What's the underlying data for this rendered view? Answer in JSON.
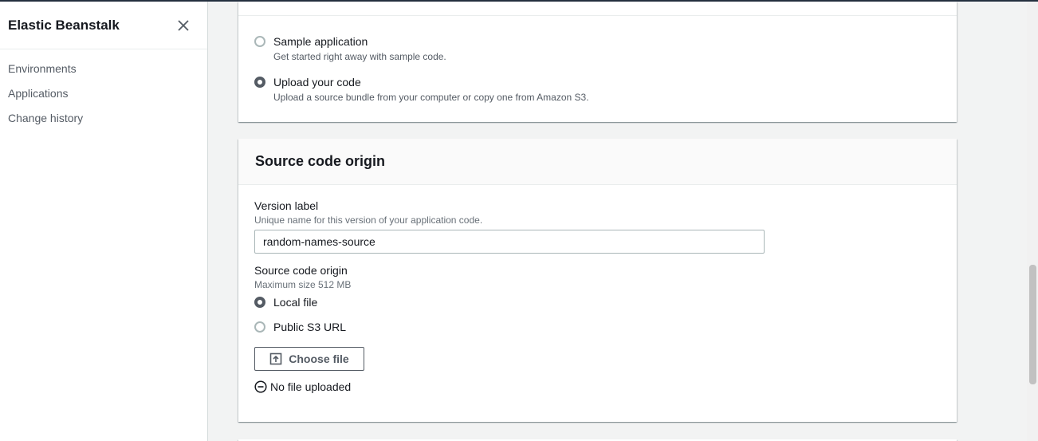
{
  "sidebar": {
    "title": "Elastic Beanstalk",
    "close_icon": "close-icon",
    "items": [
      {
        "label": "Environments"
      },
      {
        "label": "Applications"
      },
      {
        "label": "Change history"
      }
    ]
  },
  "application_code": {
    "options": [
      {
        "label": "Sample application",
        "description": "Get started right away with sample code.",
        "selected": false
      },
      {
        "label": "Upload your code",
        "description": "Upload a source bundle from your computer or copy one from Amazon S3.",
        "selected": true
      }
    ]
  },
  "source_code_origin": {
    "title": "Source code origin",
    "version_label": {
      "label": "Version label",
      "description": "Unique name for this version of your application code.",
      "value": "random-names-source"
    },
    "origin": {
      "label": "Source code origin",
      "description": "Maximum size 512 MB",
      "options": [
        {
          "label": "Local file",
          "selected": true
        },
        {
          "label": "Public S3 URL",
          "selected": false
        }
      ]
    },
    "choose_file_label": "Choose file",
    "upload_icon": "upload-icon",
    "file_status": "No file uploaded",
    "status_icon": "minus-circle-icon"
  },
  "colors": {
    "accent_dark": "#545b64",
    "text": "#16191f",
    "background": "#f2f3f3"
  }
}
